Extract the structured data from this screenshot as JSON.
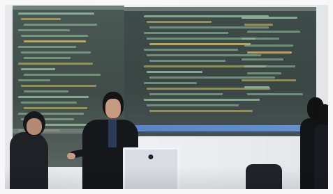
{
  "scene": {
    "photo_description": "",
    "colors": {
      "projection_bg": "#3f4d4a",
      "code_text": "#9cc7a8",
      "code_alt": "#d9c27a",
      "accent_bar": "#5b8fd6"
    }
  }
}
